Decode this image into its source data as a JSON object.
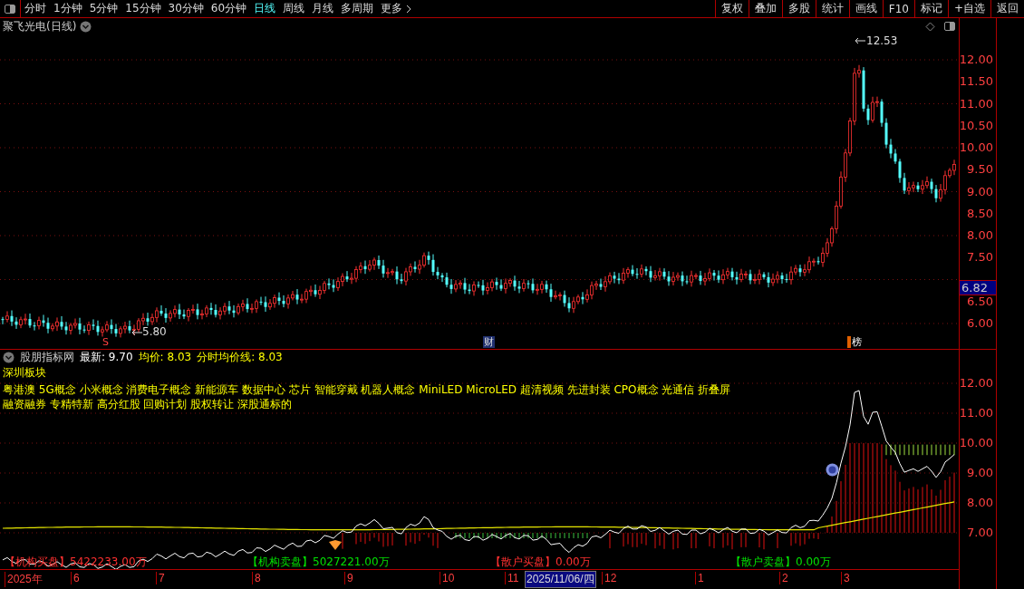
{
  "toolbar": {
    "periods": [
      {
        "label": "分时",
        "selected": false
      },
      {
        "label": "1分钟",
        "selected": false
      },
      {
        "label": "5分钟",
        "selected": false
      },
      {
        "label": "15分钟",
        "selected": false
      },
      {
        "label": "30分钟",
        "selected": false
      },
      {
        "label": "60分钟",
        "selected": false
      },
      {
        "label": "日线",
        "selected": true
      },
      {
        "label": "周线",
        "selected": false
      },
      {
        "label": "月线",
        "selected": false
      },
      {
        "label": "多周期",
        "selected": false
      },
      {
        "label": "更多",
        "selected": false
      }
    ],
    "buttons": [
      "复权",
      "叠加",
      "多股",
      "统计",
      "画线",
      "F10",
      "标记",
      "+自选",
      "返回"
    ]
  },
  "main_chart": {
    "title": "聚飞光电(日线)",
    "high_label": "12.53",
    "low_label": "5.80",
    "events": [
      {
        "kind": "signal",
        "label": "S"
      },
      {
        "kind": "report",
        "label": "财"
      },
      {
        "kind": "list",
        "label": "榜"
      }
    ],
    "price_axis": [
      "12.00",
      "11.50",
      "11.00",
      "10.50",
      "10.00",
      "9.50",
      "9.00",
      "8.50",
      "8.00",
      "7.50",
      "6.50",
      "6.00"
    ],
    "current_price": "6.82"
  },
  "indicator": {
    "name": "股朋指标网",
    "readouts": [
      {
        "label": "最新: 9.70",
        "color": "#ffffff"
      },
      {
        "label": "均价: 8.03",
        "color": "#ffff00"
      },
      {
        "label": "分时均价线: 8.03",
        "color": "#ffff00"
      }
    ],
    "sector_title": "深圳板块",
    "concept_lines": [
      "粤港澳 5G概念 小米概念 消费电子概念 新能源车 数据中心 芯片 智能穿戴 机器人概念 MiniLED MicroLED 超清视频 先进封装 CPO概念 光通信 折叠屏",
      "融资融券 专精特新 高分红股 回购计划 股权转让 深股通标的"
    ],
    "axis": [
      "12.00",
      "11.00",
      "10.00",
      "9.00",
      "8.00",
      "7.00"
    ],
    "flows": [
      {
        "label": "【机构买盘】5422233.00万",
        "color": "#ff3030"
      },
      {
        "label": "【机构卖盘】5027221.00万",
        "color": "#00e000"
      },
      {
        "label": "【散户买盘】0.00万",
        "color": "#ff3030"
      },
      {
        "label": "【散户卖盘】0.00万",
        "color": "#00e000"
      }
    ]
  },
  "date_axis": {
    "labels": [
      "2025年",
      "6",
      "7",
      "8",
      "9",
      "10",
      "11",
      "12",
      "1",
      "2",
      "3"
    ],
    "cursor": "2025/11/06/四"
  }
}
